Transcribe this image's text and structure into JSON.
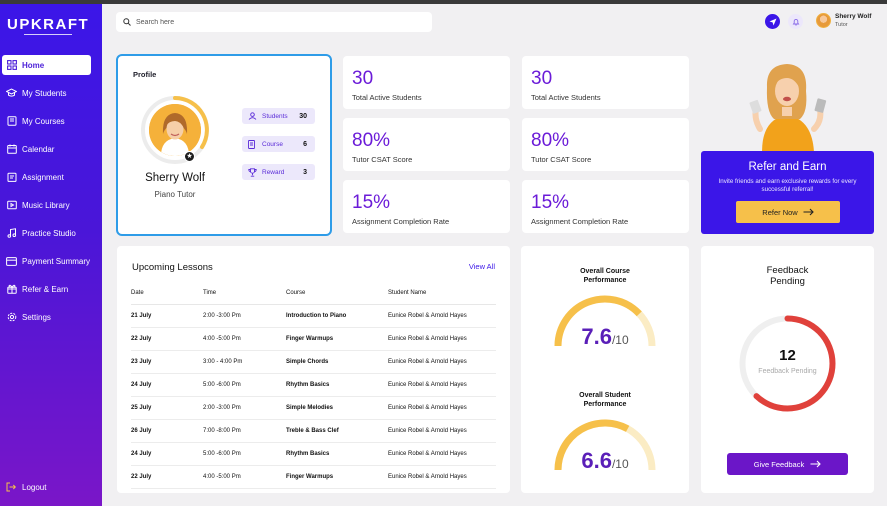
{
  "brand": {
    "logo": "UPKRAFT"
  },
  "sidebar": {
    "items": [
      {
        "label": "Home",
        "icon": "grid-icon"
      },
      {
        "label": "My Students",
        "icon": "graduation-cap-icon"
      },
      {
        "label": "My Courses",
        "icon": "book-icon"
      },
      {
        "label": "Calendar",
        "icon": "calendar-icon"
      },
      {
        "label": "Assignment",
        "icon": "clipboard-icon"
      },
      {
        "label": "Music Library",
        "icon": "library-icon"
      },
      {
        "label": "Practice Studio",
        "icon": "music-note-icon"
      },
      {
        "label": "Payment Summary",
        "icon": "card-icon"
      },
      {
        "label": "Refer & Earn",
        "icon": "gift-icon"
      },
      {
        "label": "Settings",
        "icon": "gear-icon"
      }
    ],
    "logout": "Logout"
  },
  "header": {
    "search_placeholder": "Search here",
    "user_name": "Sherry Wolf",
    "user_role": "Tutor"
  },
  "profile": {
    "title": "Profile",
    "name": "Sherry Wolf",
    "role": "Piano Tutor",
    "students_label": "Students",
    "students_value": "30",
    "course_label": "Course",
    "course_value": "6",
    "reward_label": "Reward",
    "reward_value": "3"
  },
  "stats": [
    {
      "value": "30",
      "label": "Total Active Students"
    },
    {
      "value": "30",
      "label": "Total Active Students"
    },
    {
      "value": "80%",
      "label": "Tutor CSAT Score"
    },
    {
      "value": "80%",
      "label": "Tutor CSAT Score"
    },
    {
      "value": "15%",
      "label": "Assignment Completion Rate"
    },
    {
      "value": "15%",
      "label": "Assignment Completion Rate"
    }
  ],
  "refer": {
    "title": "Refer and Earn",
    "desc": "Invite friends and earn exclusive rewards for every successful referral!",
    "button": "Refer Now"
  },
  "lessons": {
    "title": "Upcoming Lessons",
    "view_all": "View All",
    "columns": [
      "Date",
      "Time",
      "Course",
      "Student Name"
    ],
    "rows": [
      [
        "21 July",
        "2:00 -3:00 Pm",
        "Introduction to Piano",
        "Eunice Robel & Arnold Hayes"
      ],
      [
        "22 July",
        "4:00 -5:00 Pm",
        "Finger Warmups",
        "Eunice Robel & Arnold Hayes"
      ],
      [
        "23 July",
        "3:00 - 4:00 Pm",
        "Simple Chords",
        "Eunice Robel & Arnold Hayes"
      ],
      [
        "24 July",
        "5:00 -6:00 Pm",
        "Rhythm Basics",
        "Eunice Robel & Arnold Hayes"
      ],
      [
        "25 July",
        "2:00 -3:00 Pm",
        "Simple Melodies",
        "Eunice Robel & Arnold Hayes"
      ],
      [
        "26 July",
        "7:00 -8:00 Pm",
        "Treble & Bass Clef",
        "Eunice Robel & Arnold Hayes"
      ],
      [
        "24 July",
        "5:00 -6:00 Pm",
        "Rhythm Basics",
        "Eunice Robel & Arnold Hayes"
      ],
      [
        "22 July",
        "4:00 -5:00 Pm",
        "Finger Warmups",
        "Eunice Robel & Arnold Hayes"
      ]
    ]
  },
  "performance": {
    "course_title": "Overall Course Performance",
    "course_value": "7.6",
    "course_denominator": "/10",
    "course_fraction": 0.76,
    "student_title": "Overall Student Performance",
    "student_value": "6.6",
    "student_denominator": "/10",
    "student_fraction": 0.66
  },
  "feedback": {
    "title": "Feedback Pending",
    "count": "12",
    "label": "Feedback Pending",
    "fraction": 0.62,
    "button": "Give Feedback"
  },
  "colors": {
    "primary": "#3b16e8",
    "accent": "#6b1bd8",
    "gold": "#f6c04a",
    "ring_red": "#e0413b"
  }
}
